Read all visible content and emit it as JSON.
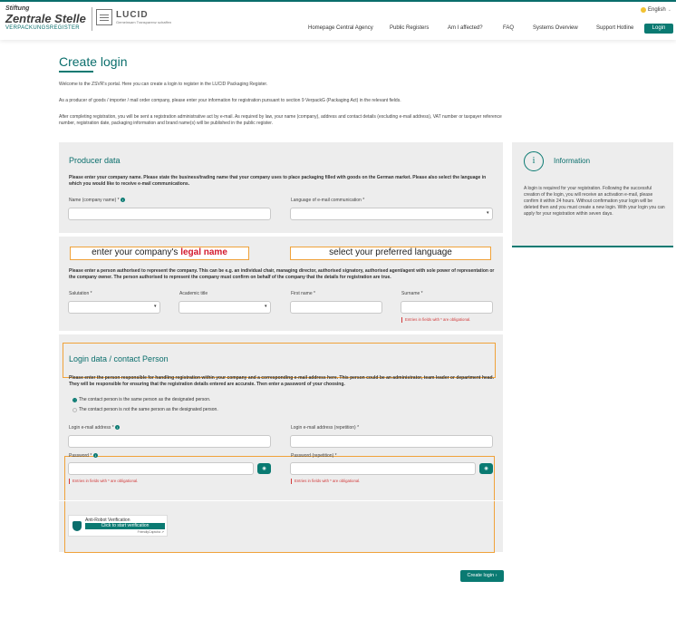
{
  "header": {
    "logo_zs_line1": "Stiftung",
    "logo_zs_line2": "Zentrale Stelle",
    "logo_zs_line3": "VERPACKUNGSREGISTER",
    "logo_lucid": "LUCID",
    "logo_lucid_sub": "Gemeinsam Transparenz schaffen",
    "nav": [
      "Homepage Central Agency",
      "Public Registers",
      "Am I affected?",
      "FAQ",
      "Systems Overview",
      "Support Hotline"
    ],
    "language": "English",
    "login_label": "Login"
  },
  "page": {
    "title": "Create login",
    "intro1": "Welcome to the ZSVR's portal. Here you can create a login to register in the LUCID Packaging Register.",
    "intro2": "As a producer of goods / importer / mail order company, please enter your information for registration pursuant to section 9 VerpackG (Packaging Act) in the relevant fields.",
    "intro3": "After completing registration, you will be sent a registration administrative act by e-mail. As required by law, your name (company), address and contact details (excluding e-mail address), VAT number or taxpayer reference number, registration date, packaging information and brand name(s) will be published in the public register."
  },
  "producer": {
    "title": "Producer data",
    "text": "Please enter your company name. Please state the business/trading name that your company uses to place packaging filled with goods on the German market. Please also select the language in which you would like to receive e-mail communications.",
    "name_label": "Name (company name) *",
    "language_label": "Language of e-mail communication *"
  },
  "annotations": {
    "legal_pre": "enter your company's ",
    "legal_red": "legal name",
    "language": "select your preferred language"
  },
  "person": {
    "text": "Please enter a person authorised to represent the company. This can be e.g. an individual chair, managing director, authorised signatory, authorised agent/agent with sole power of representation or the company owner. The person authorised to represent the company must confirm on behalf of the company that the details for registration are true.",
    "salutation_label": "Salutation *",
    "academic_label": "Academic title",
    "firstname_label": "First name *",
    "surname_label": "Surname *",
    "mandatory": "Entries in fields with * are obligational."
  },
  "login": {
    "title": "Login data / contact Person",
    "text": "Please enter the person responsible for handling registration within your company and a corresponding e-mail address here. This person could be an administrator, team leader or department head. They will be responsible for ensuring that the registration details entered are accurate. Then enter a password of your choosing.",
    "radio_same": "The contact person is the same person as the designated person.",
    "radio_not_same": "The contact person is not the same person as the designated person.",
    "email_label": "Login e-mail address *",
    "email_repeat_label": "Login e-mail address (repetition) *",
    "password_label": "Password *",
    "password_repeat_label": "Password (repetition) *",
    "mandatory": "Entries in fields with * are obligational."
  },
  "captcha": {
    "title": "Anti-Robot Verification",
    "button": "Click to start verification",
    "footer": "FriendlyCaptcha ⇗"
  },
  "create_button": "Create login  ›",
  "info": {
    "icon": "i",
    "title": "Information",
    "text": "A login is required for your registration. Following the successful creation of the login, you will receive an activation e-mail, please confirm it within 24 hours. Without confirmation your login will be deleted then and you must create a new login. With your login you can apply for your registration within seven days."
  },
  "colors": {
    "accent": "#0a7a72",
    "annotation": "#f0a23a",
    "highlight": "#d3182d"
  }
}
